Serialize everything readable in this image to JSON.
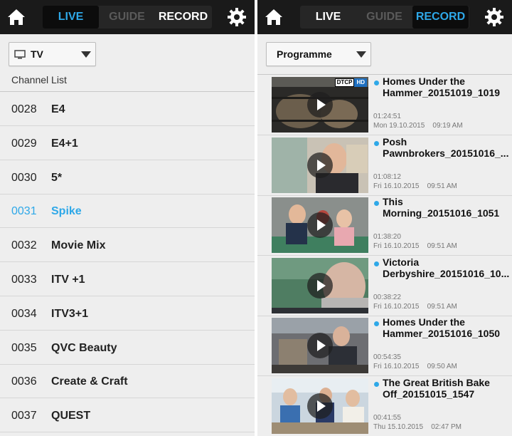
{
  "left": {
    "tabs": {
      "live": "LIVE",
      "guide": "GUIDE",
      "record": "RECORD",
      "active": "live"
    },
    "dropdown": {
      "selected": "TV"
    },
    "section_title": "Channel List",
    "channels": [
      {
        "number": "0028",
        "name": "E4"
      },
      {
        "number": "0029",
        "name": "E4+1"
      },
      {
        "number": "0030",
        "name": "5*"
      },
      {
        "number": "0031",
        "name": "Spike",
        "selected": true
      },
      {
        "number": "0032",
        "name": "Movie Mix"
      },
      {
        "number": "0033",
        "name": "ITV +1"
      },
      {
        "number": "0034",
        "name": "ITV3+1"
      },
      {
        "number": "0035",
        "name": "QVC Beauty"
      },
      {
        "number": "0036",
        "name": "Create & Craft"
      },
      {
        "number": "0037",
        "name": "QUEST"
      }
    ]
  },
  "right": {
    "tabs": {
      "live": "LIVE",
      "guide": "GUIDE",
      "record": "RECORD",
      "active": "record"
    },
    "dropdown": {
      "selected": "Programme"
    },
    "recordings": [
      {
        "title_line1": "Homes Under the",
        "title_line2": "Hammer_20151019_1019",
        "duration": "01:24:51",
        "date": "Mon 19.10.2015",
        "time": "09:19 AM",
        "badges": [
          "DTCP",
          "HD"
        ]
      },
      {
        "title_line1": "Posh",
        "title_line2": "Pawnbrokers_20151016_...",
        "duration": "01:08:12",
        "date": "Fri 16.10.2015",
        "time": "09:51 AM"
      },
      {
        "title_line1": "This",
        "title_line2": "Morning_20151016_1051",
        "duration": "01:38:20",
        "date": "Fri 16.10.2015",
        "time": "09:51 AM"
      },
      {
        "title_line1": "Victoria",
        "title_line2": "Derbyshire_20151016_10...",
        "duration": "00:38:22",
        "date": "Fri 16.10.2015",
        "time": "09:51 AM"
      },
      {
        "title_line1": "Homes Under the",
        "title_line2": "Hammer_20151016_1050",
        "duration": "00:54:35",
        "date": "Fri 16.10.2015",
        "time": "09:50 AM"
      },
      {
        "title_line1": "The Great British Bake",
        "title_line2": "Off_20151015_1547",
        "duration": "00:41:55",
        "date": "Thu 15.10.2015",
        "time": "02:47 PM"
      }
    ]
  },
  "colors": {
    "accent": "#2ea8e8",
    "topbar": "#1a1a1a",
    "background": "#eeeeee"
  },
  "icons": [
    "home-icon",
    "gear-icon",
    "tv-icon",
    "chevron-down-icon",
    "play-icon",
    "dot-icon"
  ]
}
